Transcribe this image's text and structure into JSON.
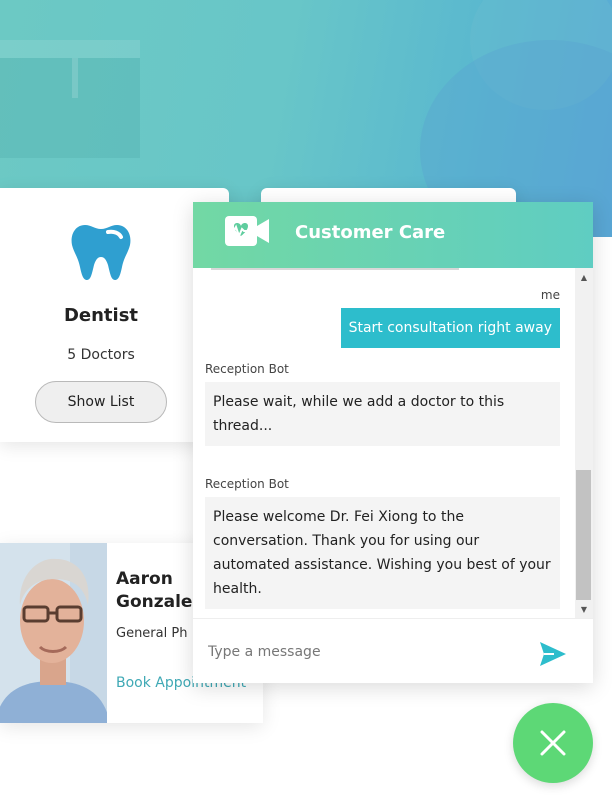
{
  "specialty_card": {
    "icon": "tooth-icon",
    "title": "Dentist",
    "count": "5 Doctors",
    "button_label": "Show List"
  },
  "doctor_card": {
    "name": "Aaron\nGonzales",
    "specialty": "General Ph",
    "book_label": "Book Appointment"
  },
  "chat": {
    "title": "Customer Care",
    "logo_icon": "video-heartbeat-icon",
    "messages": [
      {
        "sender": "me",
        "text": "Start consultation right away"
      },
      {
        "sender": "Reception Bot",
        "text": "Please wait, while we add a doctor to this thread..."
      },
      {
        "sender": "Reception Bot",
        "text": "Please welcome Dr. Fei Xiong to the conversation. Thank you for using our automated assistance. Wishing you best of your health."
      }
    ],
    "input_placeholder": "Type a message",
    "send_icon": "send-icon"
  },
  "close_button_icon": "close-icon",
  "colors": {
    "accent": "#2dbdcc",
    "header_gradient_start": "#72d8a4",
    "header_gradient_end": "#5fcdc2",
    "tooth": "#2f9fd0",
    "fab": "#5dd876",
    "link": "#3fa9b5"
  }
}
